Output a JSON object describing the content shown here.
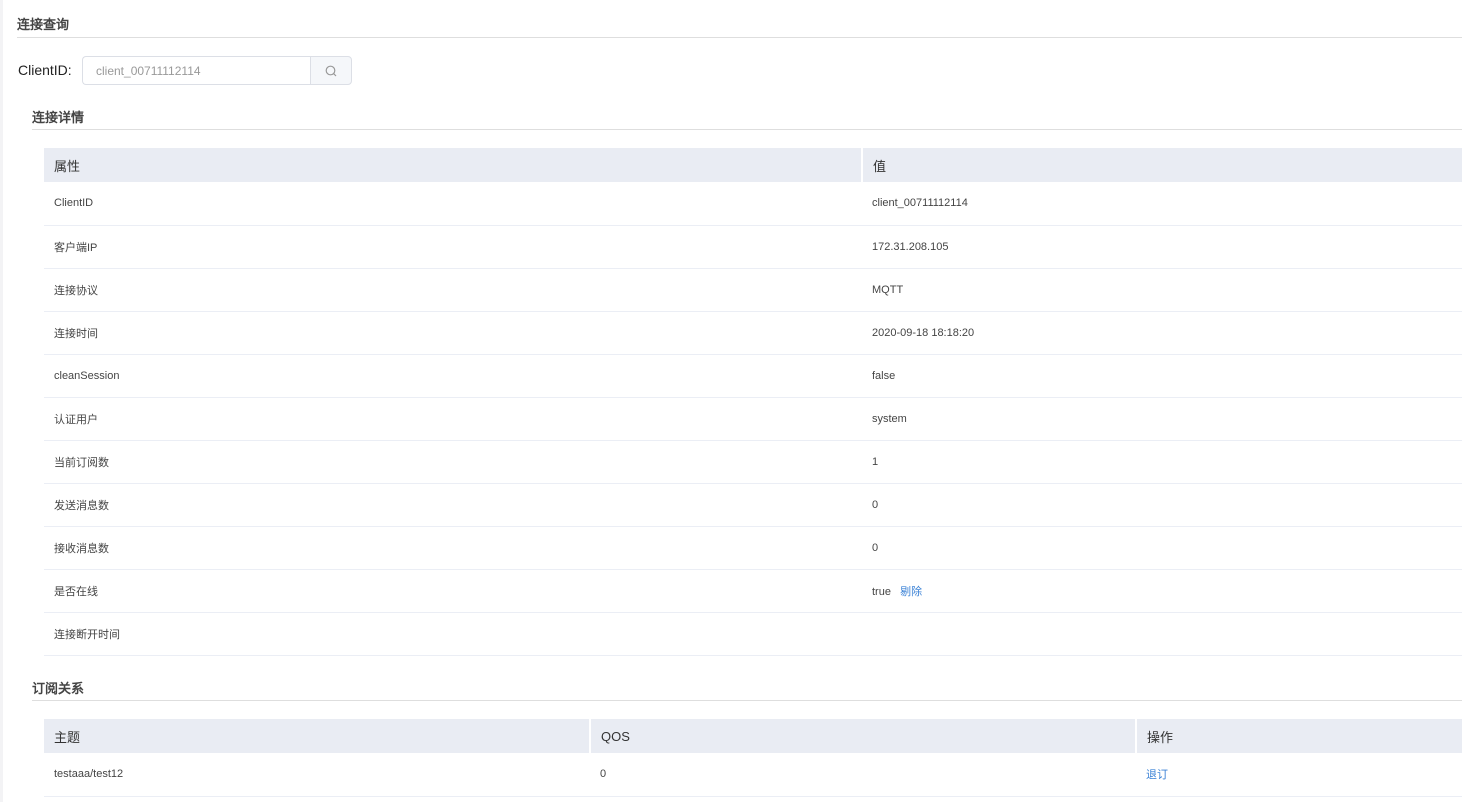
{
  "query": {
    "title": "连接查询",
    "label": "ClientID:",
    "value": "client_00711112114"
  },
  "details": {
    "title": "连接详情",
    "headers": [
      "属性",
      "值"
    ],
    "rows": [
      {
        "k": "ClientID",
        "v": "client_00711112114"
      },
      {
        "k": "客户端IP",
        "v": "172.31.208.105"
      },
      {
        "k": "连接协议",
        "v": "MQTT"
      },
      {
        "k": "连接时间",
        "v": "2020-09-18 18:18:20"
      },
      {
        "k": "cleanSession",
        "v": "false"
      },
      {
        "k": "认证用户",
        "v": "system"
      },
      {
        "k": "当前订阅数",
        "v": "1"
      },
      {
        "k": "发送消息数",
        "v": "0"
      },
      {
        "k": "接收消息数",
        "v": "0"
      },
      {
        "k": "是否在线",
        "v": "true",
        "action": "剔除"
      },
      {
        "k": "连接断开时间",
        "v": ""
      }
    ]
  },
  "subs": {
    "title": "订阅关系",
    "headers": [
      "主题",
      "QOS",
      "操作"
    ],
    "rows": [
      {
        "topic": "testaaa/test12",
        "qos": "0",
        "action": "退订"
      }
    ]
  }
}
